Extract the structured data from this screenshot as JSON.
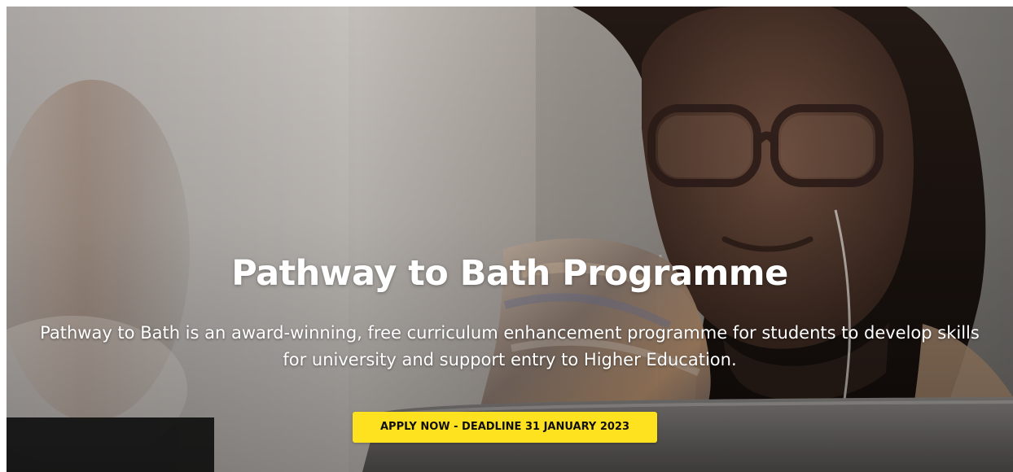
{
  "hero": {
    "title": "Pathway to Bath Programme",
    "description": "Pathway to Bath is an award-winning, free curriculum enhancement programme for students to develop skills for university and support entry to Higher Education.",
    "cta_label": "APPLY NOW - DEADLINE 31 JANUARY 2023",
    "colors": {
      "cta_background": "#ffe21f",
      "text": "#ffffff"
    }
  }
}
